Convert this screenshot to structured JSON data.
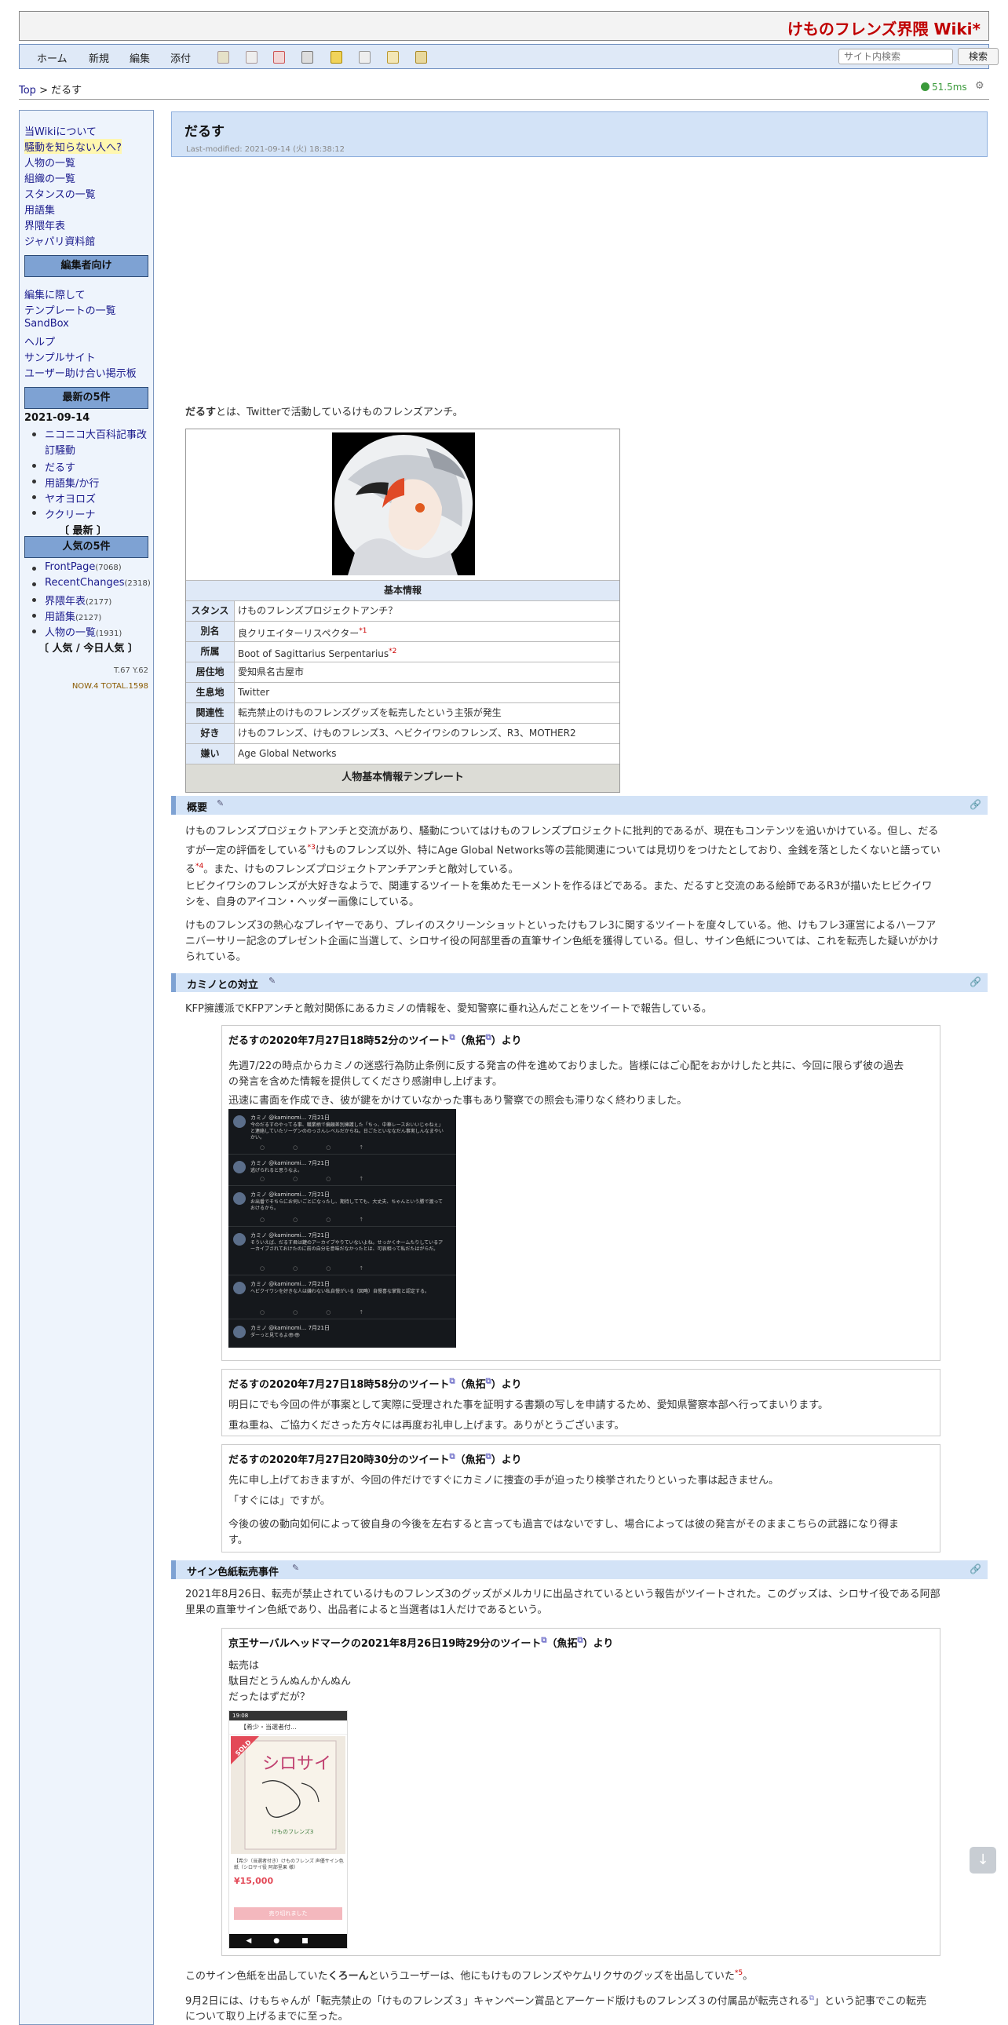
{
  "site": {
    "title": "けものフレンズ界隈 Wiki*"
  },
  "nav": {
    "items": [
      "ホーム",
      "新規",
      "編集",
      "添付"
    ],
    "search_placeholder": "サイト内検索",
    "search_button": "検索"
  },
  "breadcrumb": {
    "top": "Top",
    "sep": " > ",
    "current": "だるす"
  },
  "timer": "51.5ms",
  "sidebar": {
    "menu1": [
      "当Wikiについて",
      "騒動を知らない人へ?",
      "人物の一覧",
      "組織の一覧",
      "スタンスの一覧",
      "用語集",
      "界隈年表",
      "ジャパリ資料館"
    ],
    "editors_head": "編集者向け",
    "menu2": [
      "編集に際して",
      "テンプレートの一覧",
      "SandBox",
      "ヘルプ",
      "サンプルサイト",
      "ユーザー助け合い掲示板"
    ],
    "latest_head": "最新の5件",
    "latest_date": "2021-09-14",
    "latest_items": [
      "ニコニコ大百科記事改訂騒動",
      "だるす",
      "用語集/か行",
      "ヤオヨロズ",
      "ククリーナ"
    ],
    "latest_more": "〔 最新 〕",
    "popular_head": "人気の5件",
    "popular_items": [
      {
        "label": "FrontPage",
        "count": "(7068)"
      },
      {
        "label": "RecentChanges",
        "count": "(2318)"
      },
      {
        "label": "界隈年表",
        "count": "(2177)"
      },
      {
        "label": "用語集",
        "count": "(2127)"
      },
      {
        "label": "人物の一覧",
        "count": "(1931)"
      }
    ],
    "popular_links": "〔 人気 / 今日人気 〕",
    "counter1": "T.67 Y.62",
    "counter2": "NOW.4 TOTAL.1598"
  },
  "page": {
    "title": "だるす",
    "last_modified": "Last-modified: 2021-09-14 (火) 18:38:12",
    "intro_bold": "だるす",
    "intro_rest": "とは、Twitterで活動しているけものフレンズアンチ。"
  },
  "infobox": {
    "header": "基本情報",
    "rows": [
      {
        "key": "スタンス",
        "value": "けものフレンズプロジェクトアンチ？"
      },
      {
        "key": "別名",
        "value": "良クリエイターリスペクター"
      },
      {
        "key": "所属",
        "value": "Boot of Sagittarius Serpentarius"
      },
      {
        "key": "居住地",
        "value": "愛知県名古屋市"
      },
      {
        "key": "生息地",
        "value": "Twitter"
      },
      {
        "key": "関連性",
        "value": "転売禁止のけものフレンズグッズを転売したという主張が発生"
      },
      {
        "key": "好き",
        "value": "けものフレンズ、けものフレンズ3、ヘビクイワシのフレンズ、R3、MOTHER2"
      },
      {
        "key": "嫌い",
        "value": "Age Global Networks"
      }
    ],
    "footer": "人物基本情報テンプレート",
    "footnote_marks": [
      "*1",
      "*2"
    ]
  },
  "sections": {
    "overview": {
      "heading": "概要",
      "p1a": "けものフレンズプロジェクトアンチと交流があり、騒動についてはけものフレンズプロジェクトに批判的であるが、現在もコンテンツを追いかけている。但し、だる",
      "p1b": "すが一定の評価をしている",
      "p1b_mark": "*3",
      "p1b_rest": "けものフレンズ以外、特にAge Global Networks等の芸能関連については見切りをつけたとしており、金銭を落としたくないと語ってい",
      "p1c": "る",
      "p1c_mark": "*4",
      "p1c_rest": "。また、けものフレンズプロジェクトアンチアンチと敵対している。",
      "p2a": "ヒビクイワシのフレンズが大好きなようで、関連するツイートを集めたモーメントを作るほどである。また、だるすと交流のある絵師であるR3が描いたヒビクイワ",
      "p2b": "シを、自身のアイコン・ヘッダー画像にしている。",
      "p3a": "けものフレンズ3の熱心なプレイヤーであり、プレイのスクリーンショットといったけもフレ3に関するツイートを度々している。他、けもフレ3運営によるハーフア",
      "p3b": "ニバーサリー記念のプレゼント企画に当選して、シロサイ役の阿部里香の直筆サイン色紙を獲得している。但し、サイン色紙については、これを転売した疑いがかけ",
      "p3c": "られている。"
    },
    "kaminomi": {
      "heading": "カミノとの対立",
      "p1": "KFP擁護派でKFPアンチと敵対関係にあるカミノの情報を、愛知警察に垂れ込んだことをツイートで報告している。"
    },
    "sign": {
      "heading": "サイン色紙転売事件",
      "p1a": "2021年8月26日、転売が禁止されているけものフレンズ3のグッズがメルカリに出品されているという報告がツイートされた。このグッズは、シロサイ役である阿部",
      "p1b": "里果の直筆サイン色紙であり、出品者によると当選者は1人だけであるという。",
      "p2_pre": "このサイン色紙を出品していた",
      "p2_bold": "くろーん",
      "p2_post": "というユーザーは、他にもけものフレンズやケムリクサのグッズを出品していた",
      "p2_mark": "*5",
      "p3_pre": "9月2日には、けもちゃんが「転売禁止の「けものフレンズ３」キャンペーン賞品とアーケード版けものフレンズ３の付属品が転売される",
      "p3_post": "」という記事でこの転売",
      "p3b": "について取り上げるまでに至った。"
    }
  },
  "quotes": [
    {
      "title": "だるすの2020年7月27日18時52分のツイート",
      "suffix": "（魚拓",
      "end": "）より",
      "lines": [
        "先週7/22の時点からカミノの迷惑行為防止条例に反する発言の件を進めておりました。皆様にはご心配をおかけしたと共に、今回に限らず彼の過去",
        "の発言を含めた情報を提供してくださり感謝申し上げます。",
        "迅速に書面を作成でき、彼が鍵をかけていなかった事もあり警察での照会も滞りなく終わりました。"
      ]
    },
    {
      "title": "だるすの2020年7月27日18時58分のツイート",
      "suffix": "（魚拓",
      "end": "）より",
      "lines": [
        "明日にでも今回の件が事案として実際に受理された事を証明する書類の写しを申請するため、愛知県警察本部へ行ってまいります。",
        "重ね重ね、ご協力くださった方々には再度お礼申し上げます。ありがとうございます。"
      ]
    },
    {
      "title": "だるすの2020年7月27日20時30分のツイート",
      "suffix": "（魚拓",
      "end": "）より",
      "lines": [
        "先に申し上げておきますが、今回の件だけですぐにカミノに捜査の手が迫ったり検挙されたりといった事は起きません。",
        "「すぐには」ですが。",
        "今後の彼の動向如何によって彼自身の今後を左右すると言っても過言ではないですし、場合によっては彼の発言がそのままこちらの武器になり得ま",
        "す。"
      ]
    },
    {
      "title": "京王サーバルヘッドマークの2021年8月26日19時29分のツイート",
      "suffix": "（魚拓",
      "end": "）より",
      "lines": [
        "転売は",
        "駄目だとうんぬんかんぬん",
        "だったはずだが？"
      ]
    }
  ],
  "tweet_shot": {
    "rows": [
      {
        "name": "カミノ @kaminomi... 7月21日",
        "text": "今のだるすのやってる事、職業柄で偏頗差別擁護した「ちっ、中華レースおいいじゃねぇ」と連絡していたソーゲンののっさんレベルだからね。日ごたといななだん事実しんなまやいかい。"
      },
      {
        "name": "カミノ @kaminomi... 7月21日",
        "text": "逃げられると思うなよ。"
      },
      {
        "name": "カミノ @kaminomi... 7月21日",
        "text": "お出番でそちらにお伺いごとになったし、期待してても、大丈夫、ちゃんという勝で渡っておけるから。"
      },
      {
        "name": "カミノ @kaminomi... 7月21日",
        "text": "そういえば、だるす君は鍵のアーカイブやりていないよね。せっかくホームたりしているアーカイブされておけたのに前の自分を意味だなかったとは、可哀相って私だたはがらだ。"
      },
      {
        "name": "カミノ @kaminomi... 7月21日",
        "text": "ヘビクイワシを好きな人は嫌わない私自慢がいる（図略）自慢喜な掌覧と認定する。"
      },
      {
        "name": "カミノ @kaminomi... 7月21日",
        "text": "ダーっと見てるよ👁👁"
      }
    ]
  },
  "merc_shot": {
    "status": "19:08",
    "header": "【希少・当選者付...",
    "sold": "SOLD",
    "title": "【希少（当選者付き）けものフレンズ 声優サイン色紙（シロサイ役 阿部里果 様）",
    "price": "¥15,000",
    "button": "売り切れました"
  },
  "colors": {
    "site_title": "#c00000",
    "nav_bg": "#dfe9f7",
    "sidebar_head": "#7ea2d3",
    "h2_bg": "#d3e3f7",
    "timer": "#3a9a3a"
  },
  "icons": {
    "pencil": "pencil-icon",
    "anchor": "link-icon",
    "gear": "gear-icon",
    "external": "external-link-icon",
    "scroll": "arrow-down-icon"
  }
}
